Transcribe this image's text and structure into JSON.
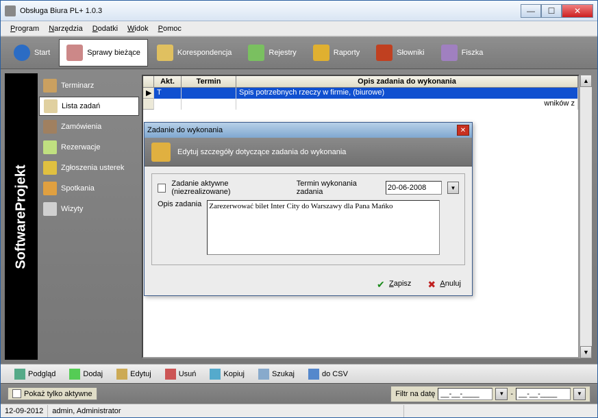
{
  "title": "Obsługa Biura PL+ 1.0.3",
  "menubar": [
    "Program",
    "Narzędzia",
    "Dodatki",
    "Widok",
    "Pomoc"
  ],
  "toolbar": [
    {
      "label": "Start"
    },
    {
      "label": "Sprawy bieżące",
      "active": true
    },
    {
      "label": "Korespondencja"
    },
    {
      "label": "Rejestry"
    },
    {
      "label": "Raporty"
    },
    {
      "label": "Słowniki"
    },
    {
      "label": "Fiszka"
    }
  ],
  "brand": "SoftwareProjekt",
  "sidebar": [
    {
      "label": "Terminarz"
    },
    {
      "label": "Lista zadań",
      "active": true
    },
    {
      "label": "Zamówienia"
    },
    {
      "label": "Rezerwacje"
    },
    {
      "label": "Zgłoszenia usterek"
    },
    {
      "label": "Spotkania"
    },
    {
      "label": "Wizyty"
    }
  ],
  "list": {
    "headers": {
      "akt": "Akt.",
      "termin": "Termin",
      "opis": "Opis zadania do wykonania"
    },
    "rows": [
      {
        "akt": "T",
        "termin": "",
        "opis": "Spis potrzebnych rzeczy w firmie, (biurowe)",
        "selected": true
      },
      {
        "akt": "",
        "termin": "",
        "opis": ""
      },
      {
        "akt": "",
        "termin": "",
        "opis": "wników z"
      }
    ]
  },
  "bottom": {
    "podglad": "Podgląd",
    "dodaj": "Dodaj",
    "edytuj": "Edytuj",
    "usun": "Usuń",
    "kopiuj": "Kopiuj",
    "szukaj": "Szukaj",
    "csv": "do CSV"
  },
  "filter": {
    "chk_label": "Pokaż tylko aktywne",
    "filtr_label": "Filtr na datę",
    "date1": "__-__-____",
    "date2": "__-__-____",
    "sep": "-"
  },
  "status": {
    "date": "12-09-2012",
    "user": "admin, Administrator"
  },
  "dialog": {
    "title": "Zadanie do wykonania",
    "banner": "Edytuj szczegóły dotyczące zadania do wykonania",
    "chk_label": "Zadanie aktywne (niezrealizowane)",
    "termin_label": "Termin wykonania zadania",
    "termin_value": "20-06-2008",
    "opis_label": "Opis zadania",
    "opis_value": "Zarezerwować bilet Inter City do Warszawy dla Pana Mańko",
    "zapisz": "Zapisz",
    "anuluj": "Anuluj"
  }
}
